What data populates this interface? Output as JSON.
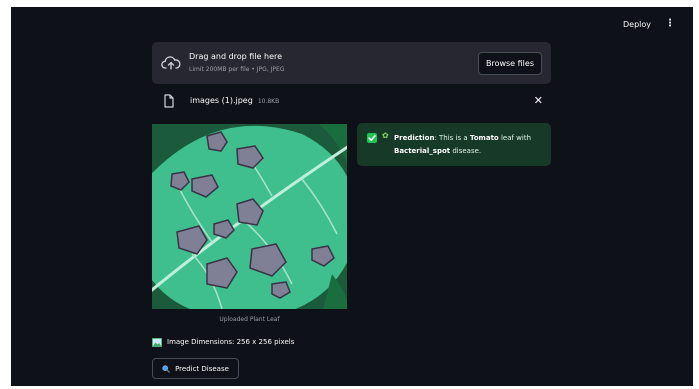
{
  "header": {
    "deploy_label": "Deploy",
    "menu_icon": "vertical-ellipsis-icon"
  },
  "uploader": {
    "title": "Drag and drop file here",
    "subtitle": "Limit 200MB per file • JPG, JPEG",
    "browse_label": "Browse files",
    "icon": "cloud-upload-icon"
  },
  "file": {
    "name": "images (1).jpeg",
    "size": "10.8KB",
    "icon": "file-icon",
    "close_icon": "close-icon"
  },
  "image": {
    "caption": "Uploaded Plant Leaf"
  },
  "prediction": {
    "label": "Prediction",
    "text_before": ": This is a ",
    "plant": "Tomato",
    "text_middle": " leaf with",
    "disease": "Bacterial_spot",
    "text_after": " disease.",
    "icons": [
      "check-box-icon",
      "sprout-icon"
    ],
    "accent_color": "#21c354"
  },
  "dimensions": {
    "text": "Image Dimensions: 256 x 256 pixels",
    "icon": "picture-icon"
  },
  "predict_button": {
    "label": "Predict Disease",
    "icon": "magnifier-icon"
  }
}
